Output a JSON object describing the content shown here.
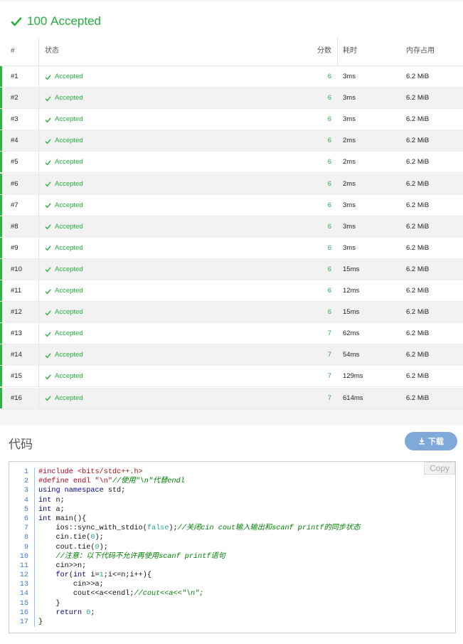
{
  "result": {
    "score": "100",
    "label": "Accepted",
    "color": "#25ad40"
  },
  "table": {
    "headers": {
      "num": "#",
      "status": "状态",
      "score": "分数",
      "time": "耗时",
      "memory": "内存占用"
    },
    "rows": [
      {
        "num": "#1",
        "status": "Accepted",
        "score": "6",
        "time": "3ms",
        "memory": "6.2 MiB"
      },
      {
        "num": "#2",
        "status": "Accepted",
        "score": "6",
        "time": "3ms",
        "memory": "6.2 MiB"
      },
      {
        "num": "#3",
        "status": "Accepted",
        "score": "6",
        "time": "3ms",
        "memory": "6.2 MiB"
      },
      {
        "num": "#4",
        "status": "Accepted",
        "score": "6",
        "time": "2ms",
        "memory": "6.2 MiB"
      },
      {
        "num": "#5",
        "status": "Accepted",
        "score": "6",
        "time": "2ms",
        "memory": "6.2 MiB"
      },
      {
        "num": "#6",
        "status": "Accepted",
        "score": "6",
        "time": "2ms",
        "memory": "6.2 MiB"
      },
      {
        "num": "#7",
        "status": "Accepted",
        "score": "6",
        "time": "3ms",
        "memory": "6.2 MiB"
      },
      {
        "num": "#8",
        "status": "Accepted",
        "score": "6",
        "time": "3ms",
        "memory": "6.2 MiB"
      },
      {
        "num": "#9",
        "status": "Accepted",
        "score": "6",
        "time": "3ms",
        "memory": "6.2 MiB"
      },
      {
        "num": "#10",
        "status": "Accepted",
        "score": "6",
        "time": "15ms",
        "memory": "6.2 MiB"
      },
      {
        "num": "#11",
        "status": "Accepted",
        "score": "6",
        "time": "12ms",
        "memory": "6.2 MiB"
      },
      {
        "num": "#12",
        "status": "Accepted",
        "score": "6",
        "time": "15ms",
        "memory": "6.2 MiB"
      },
      {
        "num": "#13",
        "status": "Accepted",
        "score": "7",
        "time": "62ms",
        "memory": "6.2 MiB"
      },
      {
        "num": "#14",
        "status": "Accepted",
        "score": "7",
        "time": "54ms",
        "memory": "6.2 MiB"
      },
      {
        "num": "#15",
        "status": "Accepted",
        "score": "7",
        "time": "129ms",
        "memory": "6.2 MiB"
      },
      {
        "num": "#16",
        "status": "Accepted",
        "score": "7",
        "time": "614ms",
        "memory": "6.2 MiB"
      }
    ]
  },
  "code_section": {
    "title": "代码",
    "download_label": "下载",
    "copy_label": "Copy",
    "lines": [
      {
        "n": "1",
        "parts": [
          {
            "t": "#include ",
            "c": "p"
          },
          {
            "t": "<bits/stdc++.h>",
            "c": "s"
          }
        ]
      },
      {
        "n": "2",
        "parts": [
          {
            "t": "#define endl ",
            "c": "p"
          },
          {
            "t": "\"\\n\"",
            "c": "s"
          },
          {
            "t": "//使用\"\\n\"代替endl",
            "c": "cm"
          }
        ]
      },
      {
        "n": "3",
        "parts": [
          {
            "t": "using namespace ",
            "c": "k"
          },
          {
            "t": "std;",
            "c": ""
          }
        ]
      },
      {
        "n": "4",
        "parts": [
          {
            "t": "int ",
            "c": "k"
          },
          {
            "t": "n;",
            "c": ""
          }
        ]
      },
      {
        "n": "5",
        "parts": [
          {
            "t": "int ",
            "c": "k"
          },
          {
            "t": "a;",
            "c": ""
          }
        ]
      },
      {
        "n": "6",
        "parts": [
          {
            "t": "int ",
            "c": "k"
          },
          {
            "t": "main(){",
            "c": ""
          }
        ]
      },
      {
        "n": "7",
        "parts": [
          {
            "t": "    ios::sync_with_stdio(",
            "c": ""
          },
          {
            "t": "false",
            "c": "n"
          },
          {
            "t": ");",
            "c": ""
          },
          {
            "t": "//关闭cin cout输入输出和scanf printf的同步状态",
            "c": "cm"
          }
        ]
      },
      {
        "n": "8",
        "parts": [
          {
            "t": "    cin.tie(",
            "c": ""
          },
          {
            "t": "0",
            "c": "n"
          },
          {
            "t": ");",
            "c": ""
          }
        ]
      },
      {
        "n": "9",
        "parts": [
          {
            "t": "    cout.tie(",
            "c": ""
          },
          {
            "t": "0",
            "c": "n"
          },
          {
            "t": ");",
            "c": ""
          }
        ]
      },
      {
        "n": "10",
        "parts": [
          {
            "t": "    //注意：以下代码不允许再使用scanf printf语句",
            "c": "cm"
          }
        ]
      },
      {
        "n": "11",
        "parts": [
          {
            "t": "    cin>>n;",
            "c": ""
          }
        ]
      },
      {
        "n": "12",
        "parts": [
          {
            "t": "    ",
            "c": ""
          },
          {
            "t": "for",
            "c": "k"
          },
          {
            "t": "(",
            "c": ""
          },
          {
            "t": "int ",
            "c": "k"
          },
          {
            "t": "i=",
            "c": ""
          },
          {
            "t": "1",
            "c": "n"
          },
          {
            "t": ";i<=n;i++){",
            "c": ""
          }
        ]
      },
      {
        "n": "13",
        "parts": [
          {
            "t": "        cin>>a;",
            "c": ""
          }
        ]
      },
      {
        "n": "14",
        "parts": [
          {
            "t": "        cout<<a<<endl;",
            "c": ""
          },
          {
            "t": "//cout<<a<<\"\\n\";",
            "c": "cm"
          }
        ]
      },
      {
        "n": "15",
        "parts": [
          {
            "t": "    }",
            "c": ""
          }
        ]
      },
      {
        "n": "16",
        "parts": [
          {
            "t": "    ",
            "c": ""
          },
          {
            "t": "return ",
            "c": "k"
          },
          {
            "t": "0",
            "c": "n"
          },
          {
            "t": ";",
            "c": ""
          }
        ]
      },
      {
        "n": "17",
        "parts": [
          {
            "t": "}",
            "c": ""
          }
        ]
      }
    ]
  }
}
